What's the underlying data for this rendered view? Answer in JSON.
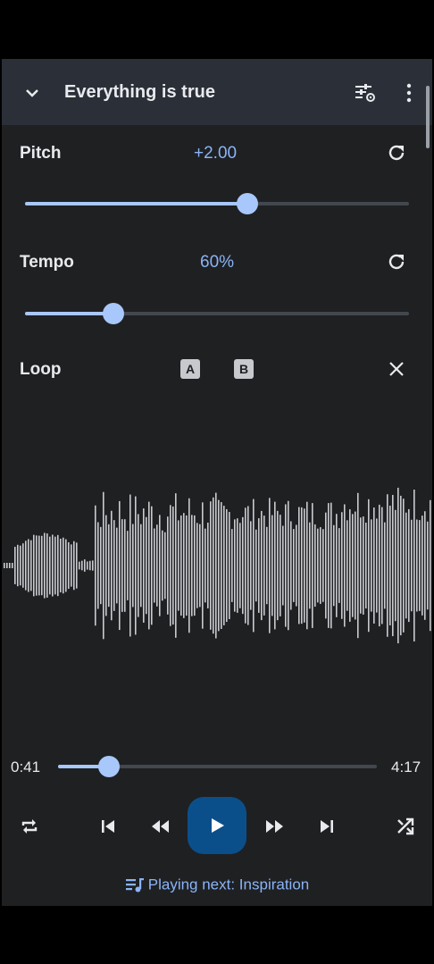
{
  "header": {
    "title": "Everything is true",
    "collapse_icon": "chevron-down-icon",
    "equalizer_icon": "tune-settings-icon",
    "menu_icon": "more-vert-icon"
  },
  "pitch": {
    "label": "Pitch",
    "value": "+2.00",
    "slider_fraction": 0.58,
    "reset_icon": "refresh-icon"
  },
  "tempo": {
    "label": "Tempo",
    "value": "60%",
    "slider_fraction": 0.23,
    "reset_icon": "refresh-icon"
  },
  "loop": {
    "label": "Loop",
    "a_label": "A",
    "b_label": "B",
    "close_icon": "close-icon"
  },
  "waveform": {
    "color": "#c9cbcf"
  },
  "playback": {
    "current_time": "0:41",
    "total_time": "4:17",
    "progress_fraction": 0.16
  },
  "controls": {
    "repeat_icon": "repeat-icon",
    "previous_icon": "skip-previous-icon",
    "rewind_icon": "fast-rewind-icon",
    "play_icon": "play-icon",
    "forward_icon": "fast-forward-icon",
    "next_icon": "skip-next-icon",
    "shuffle_icon": "shuffle-icon"
  },
  "up_next": {
    "icon": "queue-music-icon",
    "text": "Playing next: Inspiration"
  },
  "colors": {
    "accent": "#a8c7fa",
    "value_text": "#8ab4f8",
    "play_button": "#0b4f8a",
    "header_bg": "#2a2f38",
    "panel_bg": "#1f2022"
  }
}
